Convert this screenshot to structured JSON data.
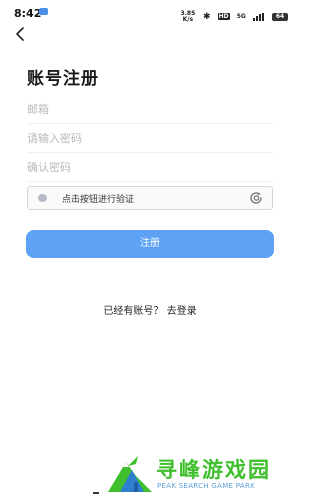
{
  "status_bar": {
    "time": "8:42",
    "net_speed": "3.85 K/s",
    "hd_label": "HD",
    "network_label": "5G",
    "battery": "64"
  },
  "page": {
    "title": "账号注册"
  },
  "form": {
    "email_placeholder": "邮箱",
    "email_value": "",
    "password_placeholder": "请输入密码",
    "password_value": "",
    "confirm_placeholder": "确认密码",
    "confirm_value": "",
    "verify_text": "点击按钮进行验证",
    "register_label": "注册",
    "login_link": "已经有账号？ 去登录"
  },
  "watermark": {
    "cn": "寻峰游戏园",
    "en": "PEAK SEARCH GAME PARK"
  },
  "colors": {
    "accent": "#5ea2f5",
    "watermark_green": "#3fbf2e"
  },
  "icons": {
    "back": "chevron-left-icon",
    "verify": "refresh-check-icon"
  }
}
